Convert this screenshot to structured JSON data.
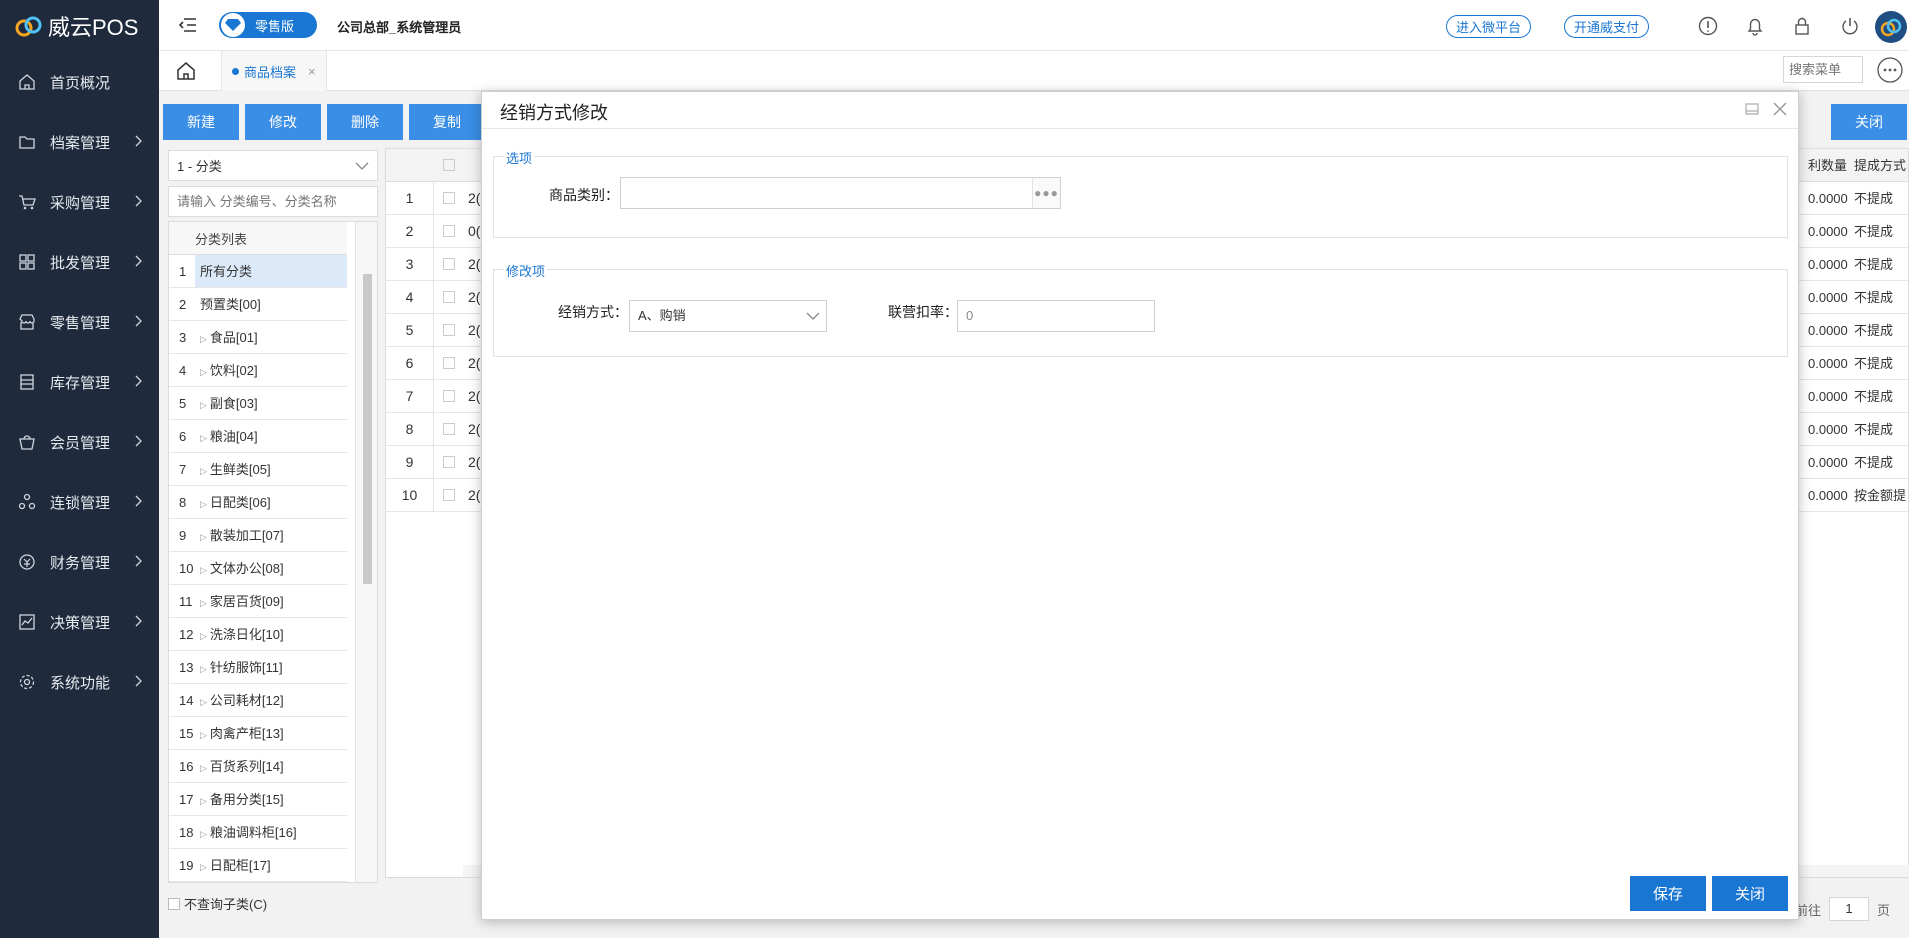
{
  "app": {
    "name": "威云POS"
  },
  "sidebar": {
    "items": [
      {
        "label": "首页概况",
        "icon": "home-icon",
        "has_children": false
      },
      {
        "label": "档案管理",
        "icon": "folder-icon",
        "has_children": true
      },
      {
        "label": "采购管理",
        "icon": "cart-icon",
        "has_children": true
      },
      {
        "label": "批发管理",
        "icon": "grid-icon",
        "has_children": true
      },
      {
        "label": "零售管理",
        "icon": "store-icon",
        "has_children": true
      },
      {
        "label": "库存管理",
        "icon": "inventory-icon",
        "has_children": true
      },
      {
        "label": "会员管理",
        "icon": "member-icon",
        "has_children": true
      },
      {
        "label": "连锁管理",
        "icon": "chain-icon",
        "has_children": true
      },
      {
        "label": "财务管理",
        "icon": "finance-icon",
        "has_children": true
      },
      {
        "label": "决策管理",
        "icon": "chart-icon",
        "has_children": true
      },
      {
        "label": "系统功能",
        "icon": "gear-icon",
        "has_children": true
      }
    ]
  },
  "header": {
    "edition": "零售版",
    "company": "公司总部_系统管理员",
    "links": [
      "进入微平台",
      "开通威支付"
    ],
    "icons": [
      "info-icon",
      "bell-icon",
      "lock-icon",
      "power-icon"
    ]
  },
  "tabs": {
    "active": "商品档案",
    "menu_search_placeholder": "搜索菜单"
  },
  "toolbar": {
    "buttons": [
      "新建",
      "修改",
      "删除",
      "复制"
    ],
    "close_label": "关闭"
  },
  "category_panel": {
    "selector": "1 - 分类",
    "search_placeholder": "请输入 分类编号、分类名称",
    "list_header": "分类列表",
    "items": [
      {
        "n": "1",
        "label": "所有分类",
        "expandable": false,
        "selected": true
      },
      {
        "n": "2",
        "label": "预置类[00]",
        "expandable": false
      },
      {
        "n": "3",
        "label": "食品[01]",
        "expandable": true
      },
      {
        "n": "4",
        "label": "饮料[02]",
        "expandable": true
      },
      {
        "n": "5",
        "label": "副食[03]",
        "expandable": true
      },
      {
        "n": "6",
        "label": "粮油[04]",
        "expandable": true
      },
      {
        "n": "7",
        "label": "生鲜类[05]",
        "expandable": true
      },
      {
        "n": "8",
        "label": "日配类[06]",
        "expandable": true
      },
      {
        "n": "9",
        "label": "散装加工[07]",
        "expandable": true
      },
      {
        "n": "10",
        "label": "文体办公[08]",
        "expandable": true
      },
      {
        "n": "11",
        "label": "家居百货[09]",
        "expandable": true
      },
      {
        "n": "12",
        "label": "洗涤日化[10]",
        "expandable": true
      },
      {
        "n": "13",
        "label": "针纺服饰[11]",
        "expandable": true
      },
      {
        "n": "14",
        "label": "公司耗材[12]",
        "expandable": true
      },
      {
        "n": "15",
        "label": "肉禽产柜[13]",
        "expandable": true
      },
      {
        "n": "16",
        "label": "百货系列[14]",
        "expandable": true
      },
      {
        "n": "17",
        "label": "备用分类[15]",
        "expandable": true
      },
      {
        "n": "18",
        "label": "粮油调料柜[16]",
        "expandable": true
      },
      {
        "n": "19",
        "label": "日配柜[17]",
        "expandable": true
      }
    ],
    "no_subcat_label": "不查询子类(C)"
  },
  "grid": {
    "headers": [
      "利数量",
      "提成方式"
    ],
    "rows": [
      {
        "n": "1",
        "id": "2(",
        "qty": "0.0000",
        "comm": "不提成"
      },
      {
        "n": "2",
        "id": "0(",
        "qty": "0.0000",
        "comm": "不提成"
      },
      {
        "n": "3",
        "id": "2(",
        "qty": "0.0000",
        "comm": "不提成"
      },
      {
        "n": "4",
        "id": "2(",
        "qty": "0.0000",
        "comm": "不提成"
      },
      {
        "n": "5",
        "id": "2(",
        "qty": "0.0000",
        "comm": "不提成"
      },
      {
        "n": "6",
        "id": "2(",
        "qty": "0.0000",
        "comm": "不提成"
      },
      {
        "n": "7",
        "id": "2(",
        "qty": "0.0000",
        "comm": "不提成"
      },
      {
        "n": "8",
        "id": "2(",
        "qty": "0.0000",
        "comm": "不提成"
      },
      {
        "n": "9",
        "id": "2(",
        "qty": "0.0000",
        "comm": "不提成"
      },
      {
        "n": "10",
        "id": "2(",
        "qty": "0.0000",
        "comm": "按金额提"
      }
    ],
    "pager": {
      "goto_label": "前往",
      "page": "1",
      "page_suffix": "页"
    }
  },
  "dialog": {
    "title": "经销方式修改",
    "options_legend": "选项",
    "category_label": "商品类别：",
    "category_value": "",
    "modify_legend": "修改项",
    "mode_label": "经销方式：",
    "mode_value": "A、购销",
    "rate_label": "联营扣率：",
    "rate_value": "0",
    "save_label": "保存",
    "close_label": "关闭"
  },
  "colors": {
    "accent": "#1976d2",
    "sidebar_bg": "#1f2b3d"
  }
}
